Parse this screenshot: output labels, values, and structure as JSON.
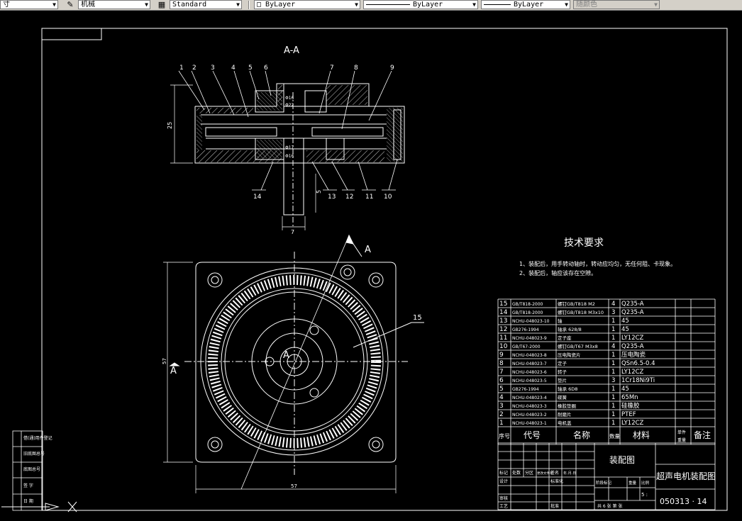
{
  "toolbar": {
    "combo1_value": "寸",
    "combo2_value": "机械",
    "combo3_value": "Standard",
    "layer_value": "ByLayer",
    "linetype_value": "ByLayer",
    "lineweight_value": "ByLayer",
    "color_value": "随颜色"
  },
  "drawing": {
    "section_title": "A-A",
    "section_marker": "A",
    "tech_req_title": "技术要求",
    "tech_req_lines": [
      "1、装配后，用手转动轴时，转动应均匀，无任何阻、卡现象。",
      "2、装配后，轴应该存在空隙。"
    ],
    "top_labels": [
      "1",
      "2",
      "3",
      "4",
      "5",
      "6",
      "7",
      "8",
      "9"
    ],
    "bottom_labels": [
      "14",
      "13",
      "12",
      "11",
      "10"
    ],
    "dim_25": "25",
    "dim_5": "5",
    "dim_7": "7",
    "dim_57v": "57",
    "dim_57h": "57",
    "label_15": "15",
    "small_dims": [
      "Φ16",
      "Φ22",
      "Φ17",
      "Φ16"
    ]
  },
  "bom": {
    "rows": [
      {
        "no": "15",
        "code": "GB/T818-2000",
        "name": "螺钉GB/T818 M2",
        "qty": "4",
        "material": "Q235-A"
      },
      {
        "no": "14",
        "code": "GB/T818-2000",
        "name": "螺钉GB/T818 M3x10",
        "qty": "3",
        "material": "Q235-A"
      },
      {
        "no": "13",
        "code": "NCHU-048023-10",
        "name": "轴",
        "qty": "1",
        "material": "45"
      },
      {
        "no": "12",
        "code": "GB276-1994",
        "name": "轴承 628/8",
        "qty": "1",
        "material": "45"
      },
      {
        "no": "11",
        "code": "NCHU-048023-9",
        "name": "定子座",
        "qty": "1",
        "material": "LY12CZ"
      },
      {
        "no": "10",
        "code": "GB/T67-2000",
        "name": "螺钉GB/T67 M3x8",
        "qty": "4",
        "material": "Q235-A"
      },
      {
        "no": "9",
        "code": "NCHU-048023-8",
        "name": "压电陶瓷片",
        "qty": "1",
        "material": "压电陶瓷"
      },
      {
        "no": "8",
        "code": "NCHU-048023-7",
        "name": "定子",
        "qty": "1",
        "material": "QSn6.5-0.4"
      },
      {
        "no": "7",
        "code": "NCHU-048023-6",
        "name": "转子",
        "qty": "1",
        "material": "LY12CZ"
      },
      {
        "no": "6",
        "code": "NCHU-048023-5",
        "name": "垫片",
        "qty": "3",
        "material": "1Cr18Ni9Ti"
      },
      {
        "no": "5",
        "code": "GB276-1994",
        "name": "轴承 6D8",
        "qty": "1",
        "material": "45"
      },
      {
        "no": "4",
        "code": "NCHU-048023-4",
        "name": "碟簧",
        "qty": "1",
        "material": "65Mn"
      },
      {
        "no": "3",
        "code": "NCHU-048023-3",
        "name": "橡胶垫圈",
        "qty": "1",
        "material": "硅橡胶"
      },
      {
        "no": "2",
        "code": "NCHU-048023-2",
        "name": "耐磨片",
        "qty": "1",
        "material": "PTEF"
      },
      {
        "no": "1",
        "code": "NCHU-048023-1",
        "name": "电机盖",
        "qty": "1",
        "material": "LY12CZ"
      }
    ],
    "header": {
      "no": "序号",
      "code": "代号",
      "name": "名称",
      "qty": "数量",
      "material": "材料",
      "weight_top": "单件",
      "weight_bottom": "重量",
      "note": "备注"
    }
  },
  "title_block": {
    "drawing_name": "装配图",
    "project_name": "超声电机装配图",
    "drawing_number": "050313 · 14",
    "sheets": "共 6 张 第 张",
    "scale": "5 :",
    "row_labels": [
      "标记",
      "处数",
      "分区",
      "更改文件号",
      "签名",
      "年.月.日"
    ],
    "labels_design": "设计",
    "labels_std": "标准化",
    "labels_review": "审核",
    "labels_process": "工艺",
    "labels_approve": "批准",
    "stage_labels": [
      "阶段标记",
      "重量",
      "比例"
    ]
  },
  "side_labels": [
    "借(通)用件登记",
    "旧底图总号",
    "底图总号",
    "签 字",
    "日 期"
  ]
}
